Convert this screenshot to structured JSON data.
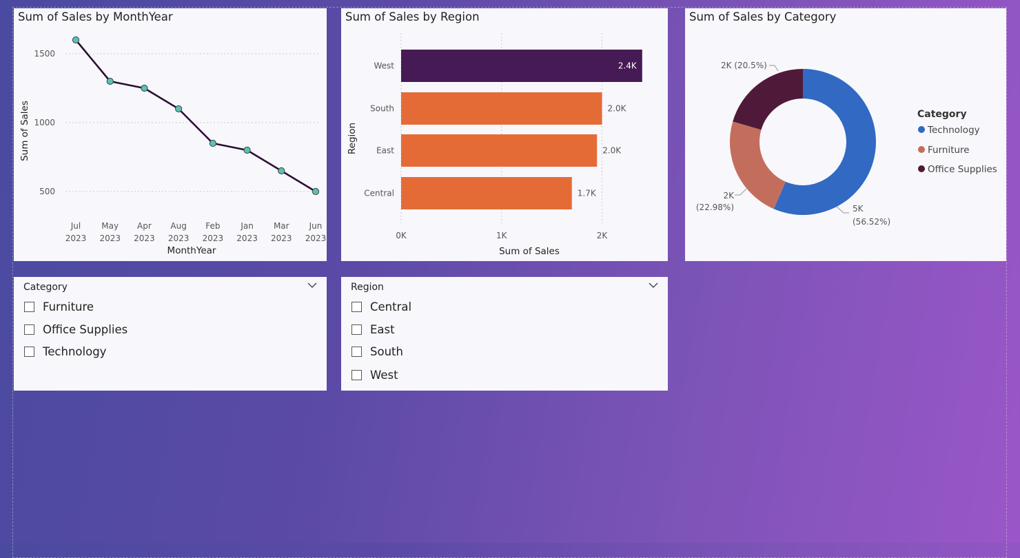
{
  "line_visual": {
    "title": "Sum of Sales by MonthYear",
    "chart_data": {
      "type": "line",
      "title": "Sum of Sales by MonthYear",
      "xlabel": "MonthYear",
      "ylabel": "Sum of Sales",
      "categories": [
        "Jul 2023",
        "May 2023",
        "Apr 2023",
        "Aug 2023",
        "Feb 2023",
        "Jan 2023",
        "Mar 2023",
        "Jun 2023"
      ],
      "x_ticks": [
        {
          "month": "Jul",
          "year": "2023"
        },
        {
          "month": "May",
          "year": "2023"
        },
        {
          "month": "Apr",
          "year": "2023"
        },
        {
          "month": "Aug",
          "year": "2023"
        },
        {
          "month": "Feb",
          "year": "2023"
        },
        {
          "month": "Jan",
          "year": "2023"
        },
        {
          "month": "Mar",
          "year": "2023"
        },
        {
          "month": "Jun",
          "year": "2023"
        }
      ],
      "values": [
        1600,
        1300,
        1250,
        1100,
        850,
        800,
        650,
        500
      ],
      "y_ticks": [
        500,
        1000,
        1500
      ],
      "ylim": [
        330,
        1680
      ],
      "grid": true,
      "line_color": "#2b0f33",
      "marker_color": "#5fbfb0"
    }
  },
  "bar_visual": {
    "title": "Sum of Sales by Region",
    "chart_data": {
      "type": "bar",
      "orientation": "horizontal",
      "title": "Sum of Sales by Region",
      "xlabel": "Sum of Sales",
      "ylabel": "Region",
      "categories": [
        "West",
        "South",
        "East",
        "Central"
      ],
      "values": [
        2400,
        2000,
        1950,
        1700
      ],
      "data_labels": [
        "2.4K",
        "2.0K",
        "2.0K",
        "1.7K"
      ],
      "x_ticks": [
        0,
        1000,
        2000
      ],
      "x_tick_labels": [
        "0K",
        "1K",
        "2K"
      ],
      "xlim": [
        0,
        2400
      ],
      "grid": true,
      "highlight_color": "#461a55",
      "bar_color": "#e56b36"
    }
  },
  "donut_visual": {
    "title": "Sum of Sales by Category",
    "chart_data": {
      "type": "pie",
      "style": "donut",
      "title": "Sum of Sales by Category",
      "legend_title": "Category",
      "legend_position": "right",
      "slices": [
        {
          "name": "Technology",
          "percent": 56.52,
          "label_value": "5K",
          "label_pct": "(56.52%)",
          "color": "#3169c3"
        },
        {
          "name": "Furniture",
          "percent": 22.98,
          "label_value": "2K",
          "label_pct": "(22.98%)",
          "color": "#c36e5c"
        },
        {
          "name": "Office Supplies",
          "percent": 20.5,
          "label_value": "2K",
          "label_pct": "(20.5%)",
          "color": "#4f1a3a"
        }
      ]
    }
  },
  "category_slicer": {
    "title": "Category",
    "options": [
      "Furniture",
      "Office Supplies",
      "Technology"
    ]
  },
  "region_slicer": {
    "title": "Region",
    "options": [
      "Central",
      "East",
      "South",
      "West"
    ]
  }
}
